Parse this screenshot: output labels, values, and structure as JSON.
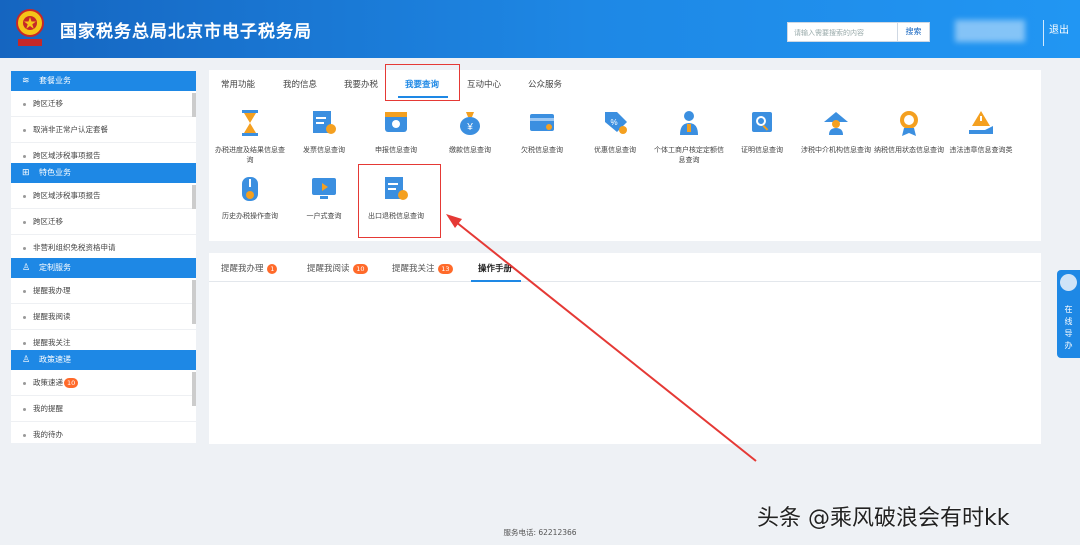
{
  "header": {
    "title": "国家税务总局北京市电子税务局",
    "search_placeholder": "请输入需要搜索的内容",
    "search_button": "搜索",
    "logout": "退出",
    "brand_color": "#1e88e5"
  },
  "sidebar": {
    "sections": [
      {
        "title": "套餐业务",
        "icon": "layers-icon",
        "items": [
          "跨区迁移",
          "取消非正常户认定套餐",
          "跨区域涉税事项报告"
        ]
      },
      {
        "title": "特色业务",
        "icon": "grid-icon",
        "items": [
          "跨区域涉税事项报告",
          "跨区迁移",
          "非营利组织免税资格申请"
        ]
      },
      {
        "title": "定制服务",
        "icon": "user-icon",
        "items": [
          "提醒我办理",
          "提醒我阅读",
          "提醒我关注"
        ]
      },
      {
        "title": "政策速递",
        "icon": "user-icon",
        "items": [
          "政策速递",
          "我的提醒",
          "我的待办"
        ],
        "badge": "10"
      }
    ]
  },
  "top_tabs": [
    "常用功能",
    "我的信息",
    "我要办税",
    "我要查询",
    "互动中心",
    "公众服务"
  ],
  "active_tab": "我要查询",
  "query_items": [
    {
      "label": "办税进度及结果信息查询",
      "icon": "hourglass-icon"
    },
    {
      "label": "发票信息查询",
      "icon": "invoice-search-icon"
    },
    {
      "label": "申报信息查询",
      "icon": "declare-search-icon"
    },
    {
      "label": "缴款信息查询",
      "icon": "money-bag-icon"
    },
    {
      "label": "欠税信息查询",
      "icon": "card-icon"
    },
    {
      "label": "优惠信息查询",
      "icon": "discount-tag-icon"
    },
    {
      "label": "个体工商户核定定额信息查询",
      "icon": "person-icon"
    },
    {
      "label": "证明信息查询",
      "icon": "certificate-search-icon"
    },
    {
      "label": "涉税中介机构信息查询",
      "icon": "agency-icon"
    },
    {
      "label": "纳税信用状态信息查询",
      "icon": "credit-medal-icon"
    },
    {
      "label": "违法违章信息查询类",
      "icon": "warning-hand-icon"
    },
    {
      "label": "历史办税操作查询",
      "icon": "history-icon"
    },
    {
      "label": "一户式查询",
      "icon": "monitor-icon"
    },
    {
      "label": "出口退税信息查询",
      "icon": "export-refund-icon"
    }
  ],
  "bottom_tabs": [
    {
      "label": "提醒我办理",
      "badge": "1"
    },
    {
      "label": "提醒我阅读",
      "badge": "10"
    },
    {
      "label": "提醒我关注",
      "badge": "13"
    },
    {
      "label": "操作手册",
      "badge": ""
    }
  ],
  "float_guide": "在线导办",
  "footer": "服务电话: 62212366",
  "watermark": "头条 @乘风破浪会有时kk",
  "colors": {
    "accent": "#1e88e5",
    "highlight": "#e53935",
    "badge": "#ff6a2a",
    "icon_blue": "#3b8fe0",
    "icon_orange": "#f4a020"
  }
}
